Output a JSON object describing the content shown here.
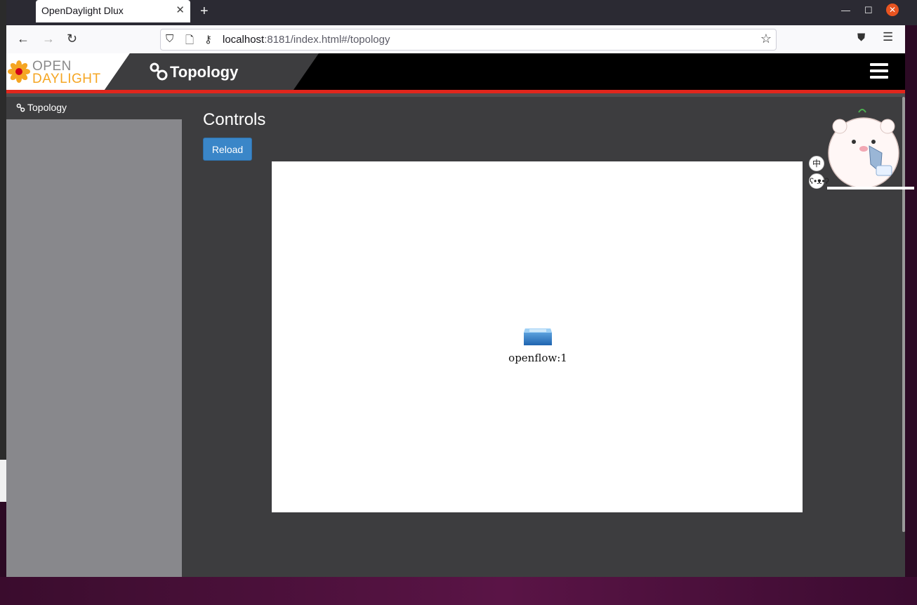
{
  "browser": {
    "tab_title": "OpenDaylight Dlux",
    "url_host": "localhost",
    "url_rest": ":8181/index.html#/topology"
  },
  "app": {
    "logo_open": "OPEN",
    "logo_daylight": "DAYLIGHT",
    "title": "Topology",
    "accent_color": "#e1261c"
  },
  "sidebar": {
    "items": [
      {
        "label": "Topology",
        "icon": "link-icon"
      }
    ]
  },
  "main": {
    "heading": "Controls",
    "reload_label": "Reload",
    "nodes": [
      {
        "label": "openflow:1",
        "icon": "switch-icon"
      }
    ]
  },
  "sticker": {
    "lang_label": "中"
  }
}
